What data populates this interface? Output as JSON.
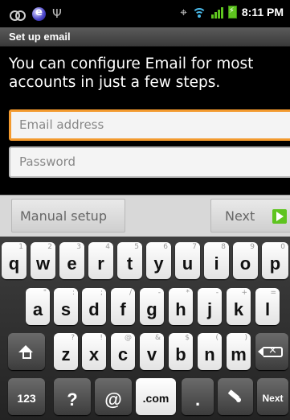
{
  "status_bar": {
    "time": "8:11 PM",
    "icons": [
      "voicemail-icon",
      "app-notification-icon",
      "usb-icon",
      "gps-icon",
      "wifi-icon",
      "signal-icon",
      "battery-charging-icon"
    ],
    "colors": {
      "wifi": "#49b7e6",
      "signal": "#5ec41f",
      "battery": "#5ec41f"
    }
  },
  "title_bar": {
    "title": "Set up email"
  },
  "intro": {
    "text": "You can configure Email for most accounts in just a few steps."
  },
  "form": {
    "email": {
      "value": "",
      "placeholder": "Email address",
      "focused": true
    },
    "password": {
      "value": "",
      "placeholder": "Password"
    }
  },
  "buttons": {
    "manual_setup": "Manual setup",
    "next": "Next"
  },
  "keyboard": {
    "row1": [
      {
        "key": "q",
        "sub": "1"
      },
      {
        "key": "w",
        "sub": "2"
      },
      {
        "key": "e",
        "sub": "3"
      },
      {
        "key": "r",
        "sub": "4"
      },
      {
        "key": "t",
        "sub": "5"
      },
      {
        "key": "y",
        "sub": "6"
      },
      {
        "key": "u",
        "sub": "7"
      },
      {
        "key": "i",
        "sub": "8"
      },
      {
        "key": "o",
        "sub": "9"
      },
      {
        "key": "p",
        "sub": "0"
      }
    ],
    "row2": [
      {
        "key": "a",
        "sub": "\""
      },
      {
        "key": "s",
        "sub": ":"
      },
      {
        "key": "d",
        "sub": ";"
      },
      {
        "key": "f",
        "sub": "/"
      },
      {
        "key": "g",
        "sub": "-"
      },
      {
        "key": "h",
        "sub": "*"
      },
      {
        "key": "j",
        "sub": "-"
      },
      {
        "key": "k",
        "sub": "+"
      },
      {
        "key": "l",
        "sub": "="
      }
    ],
    "row3": [
      {
        "key": "z",
        "sub": "?"
      },
      {
        "key": "x",
        "sub": "!"
      },
      {
        "key": "c",
        "sub": "@"
      },
      {
        "key": "v",
        "sub": "&"
      },
      {
        "key": "b",
        "sub": "$"
      },
      {
        "key": "n",
        "sub": "("
      },
      {
        "key": "m",
        "sub": ")"
      }
    ],
    "row4": {
      "symbols": "123",
      "question": "?",
      "at": "@",
      "dotcom": ".com",
      "period": ".",
      "next": "Next"
    }
  }
}
